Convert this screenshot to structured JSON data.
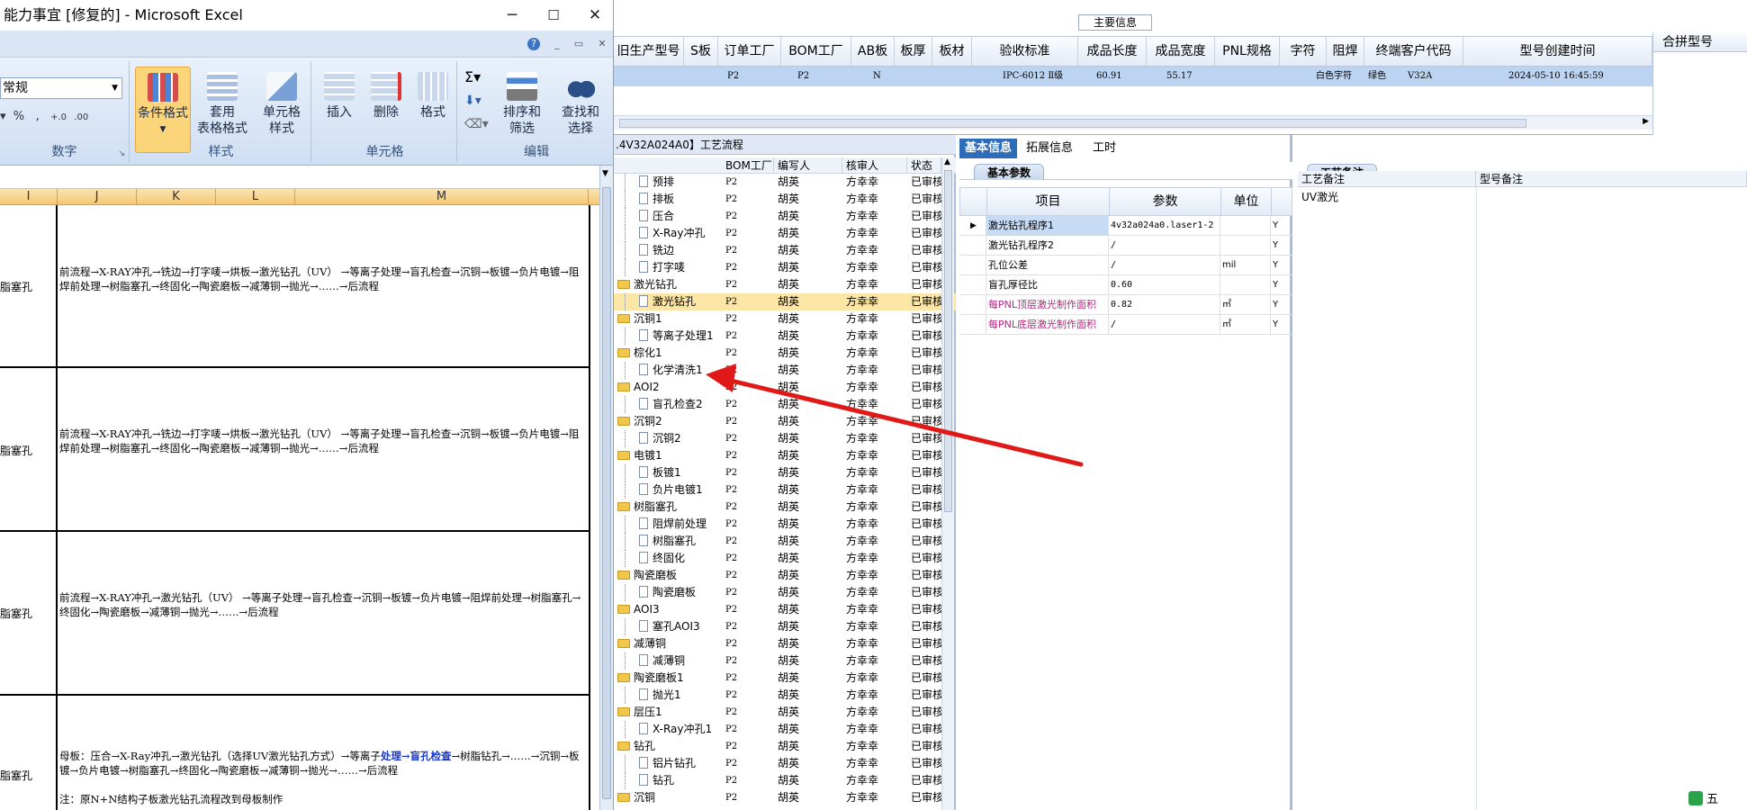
{
  "excel": {
    "title": "能力事宜 [修复的] - Microsoft Excel",
    "win_min": "─",
    "win_max": "☐",
    "win_close": "✕",
    "number_format": "常规",
    "groups": {
      "number": "数字",
      "styles": "样式",
      "cells": "单元格",
      "editing": "编辑"
    },
    "buttons": {
      "conditional_format": "条件格式",
      "table_format_1": "套用",
      "table_format_2": "表格格式",
      "cell_style_1": "单元格",
      "cell_style_2": "样式",
      "insert": "插入",
      "delete": "删除",
      "format": "格式",
      "sort_1": "排序和",
      "sort_2": "筛选",
      "find_1": "查找和",
      "find_2": "选择"
    },
    "columns": [
      "I",
      "J",
      "K",
      "L",
      "M"
    ],
    "rows": [
      {
        "left": "脂塞孔",
        "text": "前流程→X-RAY冲孔→铣边→打字唛→烘板→激光钻孔（UV） →等离子处理→盲孔检查→沉铜→板镀→负片电镀→阻焊前处理→树脂塞孔→终固化→陶瓷磨板→减薄铜→抛光→……→后流程"
      },
      {
        "left": "脂塞孔",
        "text": "前流程→X-RAY冲孔→铣边→打字唛→烘板→激光钻孔（UV） →等离子处理→盲孔检查→沉铜→板镀→负片电镀→阻焊前处理→树脂塞孔→终固化→陶瓷磨板→减薄铜→抛光→……→后流程"
      },
      {
        "left": "脂塞孔",
        "text": "前流程→X-RAY冲孔→激光钻孔（UV） →等离子处理→盲孔检查→沉铜→板镀→负片电镀→阻焊前处理→树脂塞孔→终固化→陶瓷磨板→减薄铜→抛光→……→后流程"
      }
    ],
    "row4": {
      "left": "脂塞孔",
      "text_a": "母板：压合→X-Ray冲孔→激光钻孔（选择UV激光钻孔方式）→等离子",
      "text_hl": "处理→盲孔检查",
      "text_b": "→树脂钻孔→……→沉铜→板镀→负片电镀→树脂塞孔→终固化→陶瓷磨板→减薄铜→抛光→……→后流程",
      "note": "注：原N+N结构子板激光钻孔流程改到母板制作"
    }
  },
  "app": {
    "main_info": "主要信息",
    "columns": [
      "旧生产型号",
      "S板",
      "订单工厂",
      "BOM工厂",
      "AB板",
      "板厚",
      "板材",
      "验收标准",
      "成品长度",
      "成品宽度",
      "PNL规格",
      "字符",
      "阻焊",
      "终端客户代码",
      "型号创建时间"
    ],
    "row": {
      "order_factory": "P2",
      "bom_factory": "P2",
      "ab": "N",
      "standard": "IPC-6012 Ⅱ级",
      "length": "60.91",
      "width": "55.17",
      "char": "白色字符",
      "mask": "绿色",
      "customer": "V32A",
      "created": "2024-05-10 16:45:59"
    },
    "merge_label": "合拼型号",
    "tree_title": ".4V32A024A0】工艺流程",
    "tree_cols": [
      "BOM工厂",
      "编写人",
      "核审人",
      "状态"
    ],
    "tree_rows": [
      {
        "t": "预排",
        "d": 1,
        "f": "P2",
        "a": "胡英",
        "r": "方幸幸",
        "s": "已审核"
      },
      {
        "t": "排板",
        "d": 1,
        "f": "P2",
        "a": "胡英",
        "r": "方幸幸",
        "s": "已审核"
      },
      {
        "t": "压合",
        "d": 1,
        "f": "P2",
        "a": "胡英",
        "r": "方幸幸",
        "s": "已审核"
      },
      {
        "t": "X-Ray冲孔",
        "d": 1,
        "f": "P2",
        "a": "胡英",
        "r": "方幸幸",
        "s": "已审核"
      },
      {
        "t": "铣边",
        "d": 1,
        "f": "P2",
        "a": "胡英",
        "r": "方幸幸",
        "s": "已审核"
      },
      {
        "t": "打字唛",
        "d": 1,
        "f": "P2",
        "a": "胡英",
        "r": "方幸幸",
        "s": "已审核"
      },
      {
        "t": "激光钻孔",
        "d": 0,
        "f": "P2",
        "a": "胡英",
        "r": "方幸幸",
        "s": "已审核"
      },
      {
        "t": "激光钻孔",
        "d": 1,
        "f": "P2",
        "a": "胡英",
        "r": "方幸幸",
        "s": "已审核",
        "sel": true
      },
      {
        "t": "沉铜1",
        "d": 0,
        "f": "P2",
        "a": "胡英",
        "r": "方幸幸",
        "s": "已审核"
      },
      {
        "t": "等离子处理1",
        "d": 1,
        "f": "P2",
        "a": "胡英",
        "r": "方幸幸",
        "s": "已审核"
      },
      {
        "t": "棕化1",
        "d": 0,
        "f": "P2",
        "a": "胡英",
        "r": "方幸幸",
        "s": "已审核"
      },
      {
        "t": "化学清洗1",
        "d": 1,
        "f": "P2",
        "a": "胡英",
        "r": "方幸幸",
        "s": "已审核"
      },
      {
        "t": "AOI2",
        "d": 0,
        "f": "P2",
        "a": "胡英",
        "r": "方幸幸",
        "s": "已审核"
      },
      {
        "t": "盲孔检查2",
        "d": 1,
        "f": "P2",
        "a": "胡英",
        "r": "方幸幸",
        "s": "已审核"
      },
      {
        "t": "沉铜2",
        "d": 0,
        "f": "P2",
        "a": "胡英",
        "r": "方幸幸",
        "s": "已审核"
      },
      {
        "t": "沉铜2",
        "d": 1,
        "f": "P2",
        "a": "胡英",
        "r": "方幸幸",
        "s": "已审核"
      },
      {
        "t": "电镀1",
        "d": 0,
        "f": "P2",
        "a": "胡英",
        "r": "方幸幸",
        "s": "已审核"
      },
      {
        "t": "板镀1",
        "d": 1,
        "f": "P2",
        "a": "胡英",
        "r": "方幸幸",
        "s": "已审核"
      },
      {
        "t": "负片电镀1",
        "d": 1,
        "f": "P2",
        "a": "胡英",
        "r": "方幸幸",
        "s": "已审核"
      },
      {
        "t": "树脂塞孔",
        "d": 0,
        "f": "P2",
        "a": "胡英",
        "r": "方幸幸",
        "s": "已审核"
      },
      {
        "t": "阻焊前处理",
        "d": 1,
        "f": "P2",
        "a": "胡英",
        "r": "方幸幸",
        "s": "已审核"
      },
      {
        "t": "树脂塞孔",
        "d": 1,
        "f": "P2",
        "a": "胡英",
        "r": "方幸幸",
        "s": "已审核"
      },
      {
        "t": "终固化",
        "d": 1,
        "f": "P2",
        "a": "胡英",
        "r": "方幸幸",
        "s": "已审核"
      },
      {
        "t": "陶瓷磨板",
        "d": 0,
        "f": "P2",
        "a": "胡英",
        "r": "方幸幸",
        "s": "已审核"
      },
      {
        "t": "陶瓷磨板",
        "d": 1,
        "f": "P2",
        "a": "胡英",
        "r": "方幸幸",
        "s": "已审核"
      },
      {
        "t": "AOI3",
        "d": 0,
        "f": "P2",
        "a": "胡英",
        "r": "方幸幸",
        "s": "已审核"
      },
      {
        "t": "塞孔AOI3",
        "d": 1,
        "f": "P2",
        "a": "胡英",
        "r": "方幸幸",
        "s": "已审核"
      },
      {
        "t": "减薄铜",
        "d": 0,
        "f": "P2",
        "a": "胡英",
        "r": "方幸幸",
        "s": "已审核"
      },
      {
        "t": "减薄铜",
        "d": 1,
        "f": "P2",
        "a": "胡英",
        "r": "方幸幸",
        "s": "已审核"
      },
      {
        "t": "陶瓷磨板1",
        "d": 0,
        "f": "P2",
        "a": "胡英",
        "r": "方幸幸",
        "s": "已审核"
      },
      {
        "t": "抛光1",
        "d": 1,
        "f": "P2",
        "a": "胡英",
        "r": "方幸幸",
        "s": "已审核"
      },
      {
        "t": "层压1",
        "d": 0,
        "f": "P2",
        "a": "胡英",
        "r": "方幸幸",
        "s": "已审核"
      },
      {
        "t": "X-Ray冲孔1",
        "d": 1,
        "f": "P2",
        "a": "胡英",
        "r": "方幸幸",
        "s": "已审核"
      },
      {
        "t": "钻孔",
        "d": 0,
        "f": "P2",
        "a": "胡英",
        "r": "方幸幸",
        "s": "已审核"
      },
      {
        "t": "铝片钻孔",
        "d": 1,
        "f": "P2",
        "a": "胡英",
        "r": "方幸幸",
        "s": "已审核"
      },
      {
        "t": "钻孔",
        "d": 1,
        "f": "P2",
        "a": "胡英",
        "r": "方幸幸",
        "s": "已审核"
      },
      {
        "t": "沉铜",
        "d": 0,
        "f": "P2",
        "a": "胡英",
        "r": "方幸幸",
        "s": "已审核"
      }
    ],
    "tabs": [
      "基本信息",
      "拓展信息",
      "工时"
    ],
    "subtab": "基本参数",
    "param_cols": [
      "项目",
      "参数",
      "单位"
    ],
    "params": [
      {
        "item": "激光钻孔程序1",
        "value": "4v32a024a0.laser1-2",
        "unit": "",
        "flag": "Y",
        "pink": false,
        "sel": true
      },
      {
        "item": "激光钻孔程序2",
        "value": "/",
        "unit": "",
        "flag": "Y",
        "pink": false
      },
      {
        "item": "孔位公差",
        "value": "/",
        "unit": "mil",
        "flag": "Y",
        "pink": false
      },
      {
        "item": "盲孔厚径比",
        "value": "0.60",
        "unit": "",
        "flag": "Y",
        "pink": false
      },
      {
        "item": "每PNL顶层激光制作面积",
        "value": "0.82",
        "unit": "㎡",
        "flag": "Y",
        "pink": true
      },
      {
        "item": "每PNL底层激光制作面积",
        "value": "/",
        "unit": "㎡",
        "flag": "Y",
        "pink": true
      }
    ],
    "note_tab": "工艺备注",
    "note_cols": [
      "工艺备注",
      "型号备注"
    ],
    "note_value": "UV激光",
    "ime": "五"
  }
}
